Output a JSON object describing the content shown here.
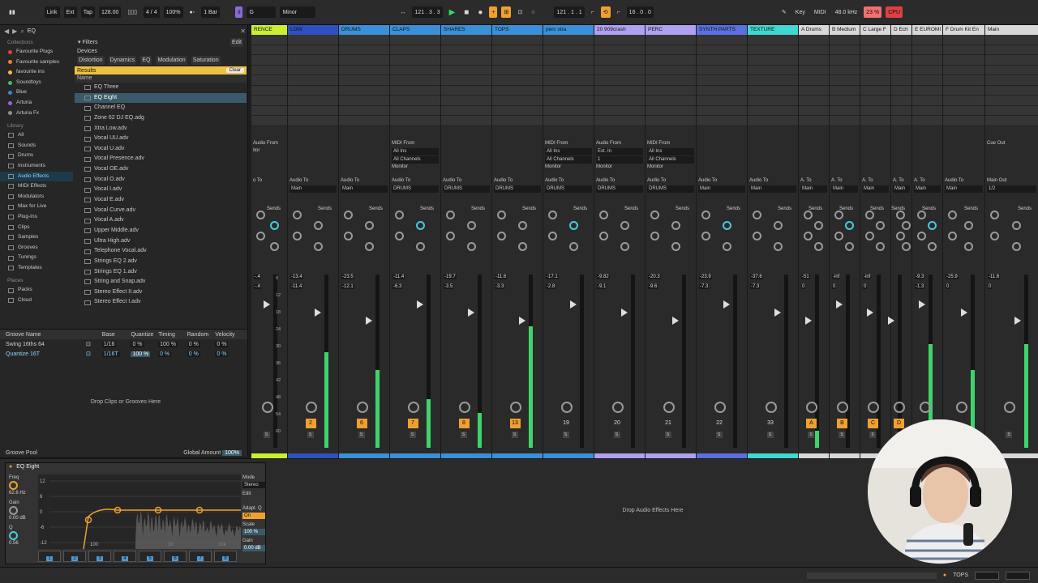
{
  "transport": {
    "link": "Link",
    "ext": "Ext",
    "tap": "Tap",
    "tempo": "128.00",
    "meter": "4 / 4",
    "zoom": "100%",
    "quantize": "1 Bar",
    "key_root": "G",
    "key_scale": "Minor",
    "position": "121 .  3 .  3",
    "loop_start": "121 .  1 .  1",
    "loop_length": "16 .  0 .  0",
    "key_label": "Key",
    "midi_label": "MIDI",
    "sample_rate": "48.0 kHz",
    "cpu_pct": "23 %",
    "cpu_label": "CPU"
  },
  "browser": {
    "search_value": "EQ",
    "collections_title": "Collections",
    "collections": [
      {
        "label": "Favourite Plugs",
        "color": "#e04040"
      },
      {
        "label": "Favourite samples",
        "color": "#f08030"
      },
      {
        "label": "favourite ins",
        "color": "#f0c040"
      },
      {
        "label": "Soundtoys",
        "color": "#40c060"
      },
      {
        "label": "Blue",
        "color": "#4080e0"
      },
      {
        "label": "Arturia",
        "color": "#a060e0"
      },
      {
        "label": "Arturia Fx",
        "color": "#909090"
      }
    ],
    "library_title": "Library",
    "library": [
      {
        "label": "All",
        "selected": false
      },
      {
        "label": "Sounds",
        "selected": false
      },
      {
        "label": "Drums",
        "selected": false
      },
      {
        "label": "Instruments",
        "selected": false
      },
      {
        "label": "Audio Effects",
        "selected": true
      },
      {
        "label": "MIDI Effects",
        "selected": false
      },
      {
        "label": "Modulators",
        "selected": false
      },
      {
        "label": "Max for Live",
        "selected": false
      },
      {
        "label": "Plug-Ins",
        "selected": false
      },
      {
        "label": "Clips",
        "selected": false
      },
      {
        "label": "Samples",
        "selected": false
      },
      {
        "label": "Grooves",
        "selected": false
      },
      {
        "label": "Tunings",
        "selected": false
      },
      {
        "label": "Templates",
        "selected": false
      }
    ],
    "places_title": "Places",
    "places": [
      {
        "label": "Packs"
      },
      {
        "label": "Cloud"
      }
    ],
    "filters_label": "Filters",
    "edit_label": "Edit",
    "devices_label": "Devices",
    "filter_tags": [
      "Distortion",
      "Dynamics",
      "EQ",
      "Modulation",
      "Saturation"
    ],
    "results_label": "Results",
    "clear_label": "Clear",
    "name_header": "Name",
    "results": [
      {
        "label": "EQ Three",
        "selected": false
      },
      {
        "label": "EQ Eight",
        "selected": true
      },
      {
        "label": "Channel EQ",
        "selected": false
      },
      {
        "label": "Zone 62 DJ EQ.adg",
        "selected": false
      },
      {
        "label": "Xtra Low.adv",
        "selected": false
      },
      {
        "label": "Vocal UU.adv",
        "selected": false
      },
      {
        "label": "Vocal U.adv",
        "selected": false
      },
      {
        "label": "Vocal Presence.adv",
        "selected": false
      },
      {
        "label": "Vocal OE.adv",
        "selected": false
      },
      {
        "label": "Vocal O.adv",
        "selected": false
      },
      {
        "label": "Vocal I.adv",
        "selected": false
      },
      {
        "label": "Vocal E.adv",
        "selected": false
      },
      {
        "label": "Vocal Curve.adv",
        "selected": false
      },
      {
        "label": "Vocal A.adv",
        "selected": false
      },
      {
        "label": "Upper Middle.adv",
        "selected": false
      },
      {
        "label": "Ultra High.adv",
        "selected": false
      },
      {
        "label": "Telephone Vocal.adv",
        "selected": false
      },
      {
        "label": "Strings EQ 2.adv",
        "selected": false
      },
      {
        "label": "Strings EQ 1.adv",
        "selected": false
      },
      {
        "label": "String and Snap.adv",
        "selected": false
      },
      {
        "label": "Stereo Effect II.adv",
        "selected": false
      },
      {
        "label": "Stereo Effect I.adv",
        "selected": false
      }
    ]
  },
  "groove_pool": {
    "headers": [
      "Groove Name",
      "Base",
      "Quantize",
      "Timing",
      "Random",
      "Velocity"
    ],
    "rows": [
      {
        "name": "Swing 16ths 64",
        "base": "1/16",
        "quantize": "0 %",
        "timing": "100 %",
        "random": "0 %",
        "velocity": "0 %",
        "selected": false
      },
      {
        "name": "Quantize 16T",
        "base": "1/16T",
        "quantize": "100 %",
        "timing": "0 %",
        "random": "0 %",
        "velocity": "0 %",
        "selected": true
      }
    ],
    "drop_hint": "Drop Clips or Grooves Here",
    "footer_title": "Groove Pool",
    "global_amount_label": "Global Amount",
    "global_amount": "100%"
  },
  "tracks": [
    {
      "name": "RENCE",
      "color": "#c8f030",
      "io_from": "Audio From",
      "monitor": "itor",
      "to": "o To",
      "vol": "-.4",
      "vol2": "-.4",
      "num": "",
      "meter": 0.0
    },
    {
      "name": "LOW",
      "color": "#3050c0",
      "io_from": "",
      "monitor": "",
      "to": "Audio To",
      "route": "Main",
      "vol": "-13.4",
      "vol2": "-11.4",
      "num": "2",
      "meter": 0.55
    },
    {
      "name": "DRUMS",
      "color": "#3a90d8",
      "io_from": "",
      "monitor": "",
      "to": "Audio To",
      "route": "Main",
      "vol": "-23.5",
      "vol2": "-12.1",
      "num": "6",
      "meter": 0.45
    },
    {
      "name": "CLAPS",
      "color": "#3a90d8",
      "io_from": "MIDI From",
      "from_val": "All Ins",
      "ch": "All Channels",
      "monitor": "Monitor",
      "to": "Audio To",
      "route": "DRUMS",
      "vol": "-11.4",
      "vol2": "-6.3",
      "num": "7",
      "meter": 0.28
    },
    {
      "name": "SHARES",
      "color": "#3a90d8",
      "io_from": "",
      "monitor": "",
      "to": "Audio To",
      "route": "DRUMS",
      "vol": "-19.7",
      "vol2": "-3.5",
      "num": "8",
      "meter": 0.2
    },
    {
      "name": "TOPS",
      "color": "#3a90d8",
      "io_from": "",
      "monitor": "",
      "to": "Audio To",
      "route": "DRUMS",
      "vol": "-11.6",
      "vol2": "-3.3",
      "num": "13",
      "meter": 0.7
    },
    {
      "name": "perc xtra",
      "color": "#3a90d8",
      "io_from": "MIDI From",
      "from_val": "All Ins",
      "ch": "All Channels",
      "monitor": "Monitor",
      "to": "Audio To",
      "route": "DRUMS",
      "vol": "-17.1",
      "vol2": "-2.8",
      "num": "19",
      "meter": 0.0
    },
    {
      "name": "20 909crash",
      "color": "#b0a0f0",
      "io_from": "Audio From",
      "from_val": "Ext. In",
      "ch": "1",
      "monitor": "Monitor",
      "to": "Audio To",
      "route": "DRUMS",
      "vol": "-9.82",
      "vol2": "-9.1",
      "num": "20",
      "meter": 0.0
    },
    {
      "name": "PERC",
      "color": "#b0a0f0",
      "io_from": "MIDI From",
      "from_val": "All Ins",
      "ch": "All Channels",
      "monitor": "Monitor",
      "to": "Audio To",
      "route": "DRUMS",
      "vol": "-20.3",
      "vol2": "-9.6",
      "num": "21",
      "meter": 0.0
    },
    {
      "name": "SYNTH PARTS",
      "color": "#5a70e0",
      "io_from": "",
      "monitor": "",
      "to": "Audio To",
      "route": "Main",
      "vol": "-23.9",
      "vol2": "-7.3",
      "num": "22",
      "meter": 0.0
    },
    {
      "name": "TEXTURE",
      "color": "#40d8d0",
      "io_from": "",
      "monitor": "",
      "to": "Audio To",
      "route": "Main",
      "vol": "-37.6",
      "vol2": "-7.3",
      "num": "33",
      "meter": 0.0
    },
    {
      "name": "A Drums",
      "color": "#d8d8d8",
      "io_from": "",
      "monitor": "",
      "to": "A. To",
      "route": "Main",
      "vol": "-51",
      "vol2": "0",
      "num": "A",
      "meter": 0.1
    },
    {
      "name": "B Medium",
      "color": "#d8d8d8",
      "io_from": "",
      "monitor": "",
      "to": "A. To",
      "route": "Main",
      "vol": "-inf",
      "vol2": "0",
      "num": "B",
      "meter": 0.0
    },
    {
      "name": "C Large F",
      "color": "#d8d8d8",
      "io_from": "",
      "monitor": "",
      "to": "A. To",
      "route": "Main",
      "vol": "-inf",
      "vol2": "0",
      "num": "C",
      "meter": 0.0
    },
    {
      "name": "D Ech",
      "color": "#d8d8d8",
      "io_from": "",
      "monitor": "",
      "to": "A. To",
      "route": "Main",
      "vol": "",
      "vol2": "",
      "num": "D",
      "meter": 0.0
    },
    {
      "name": "E EUROMI",
      "color": "#d8d8d8",
      "io_from": "",
      "monitor": "",
      "to": "A. To",
      "route": "Main",
      "vol": "-9.3",
      "vol2": "-1.3",
      "num": "",
      "meter": 0.6
    },
    {
      "name": "F Drum Kit En",
      "color": "#d8d8d8",
      "io_from": "",
      "monitor": "",
      "to": "Audio To",
      "route": "Main",
      "vol": "-25.9",
      "vol2": "0",
      "num": "",
      "meter": 0.45
    },
    {
      "name": "Main",
      "color": "#d8d8d8",
      "io_from": "",
      "monitor": "Cue Out",
      "to": "Main Out",
      "route": "1/2",
      "vol": "-11.6",
      "vol2": "0",
      "num": "",
      "meter": 0.6
    }
  ],
  "device": {
    "name": "EQ Eight",
    "freq_label": "Freq",
    "freq_val": "62.6 Hz",
    "gain_label": "Gain",
    "gain_val": "0.00 dB",
    "q_label": "Q",
    "q_val": "0.56",
    "mode_label": "Mode",
    "mode_val": "Stereo",
    "edit_label": "Edit",
    "adapt_label": "Adapt. Q",
    "adapt_val": "On",
    "scale_label": "Scale",
    "scale_val": "100 %",
    "out_gain_label": "Gain",
    "out_gain_val": "0.00 dB",
    "axis_labels": [
      "12",
      "6",
      "0",
      "-6",
      "-12"
    ],
    "freq_labels": [
      "100",
      "1k",
      "10k"
    ],
    "bands": [
      "1",
      "2",
      "3",
      "4",
      "5",
      "6",
      "7",
      "8"
    ],
    "drop_hint": "Drop Audio Effects Here"
  },
  "status": {
    "track_label": "TOPS"
  }
}
